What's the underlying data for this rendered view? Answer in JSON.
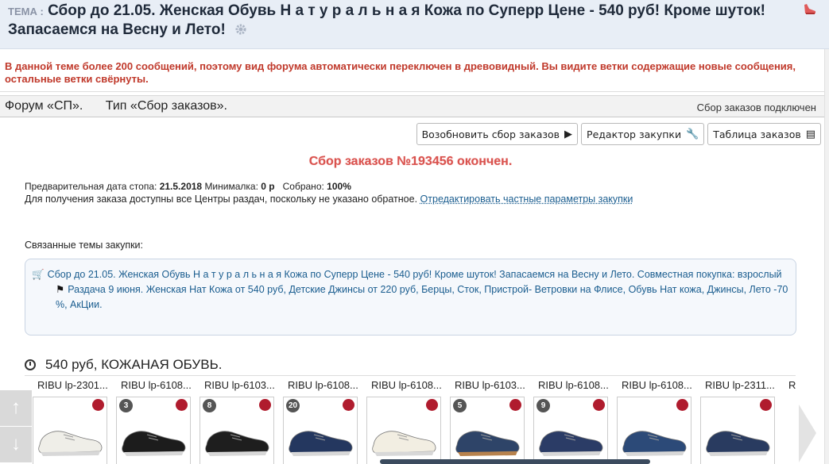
{
  "topic": {
    "label": "ТЕМА :",
    "title": "Сбор до 21.05. Женская Обувь Н а т у р а л ь н а я Кожа по Суперр Цене - 540 руб! Кроме шуток! Запасаемся на Весну и Лето!"
  },
  "notice": "В данной теме более 200 сообщений, поэтому вид форума автоматически переключен в древовидный. Вы видите ветки содержащие новые сообщения, остальные ветки свёрнуты.",
  "forum_bar": {
    "forum": "Форум «СП».",
    "type": "Тип «Сбор заказов».",
    "status": "Сбор заказов подключен"
  },
  "buttons": {
    "resume": "Возобновить сбор заказов",
    "editor": "Редактор закупки",
    "table": "Таблица заказов"
  },
  "order_status": "Сбор заказов №193456 окончен.",
  "info": {
    "stop_label": "Предварительная дата стопа:",
    "stop_value": "21.5.2018",
    "min_label": "Минималка:",
    "min_value": "0 р",
    "collected_label": "Собрано:",
    "collected_value": "100%",
    "pickup_text": "Для получения заказа доступны все Центры раздач, поскольку не указано обратное.",
    "edit_link": "Отредактировать частные параметры закупки"
  },
  "related": {
    "label": "Связанные темы закупки:",
    "topic1": "Сбор до 21.05. Женская Обувь Н а т у р а л ь н а я Кожа по Суперр Цене - 540 руб! Кроме шуток! Запасаемся на Весну и Лето. Совместная покупка: взрослый",
    "topic2": "Раздача 9 июня. Женская Нат Кожа от 540 руб, Детские Джинсы от 220 руб, Берцы, Сток, Пристрой- Ветровки на Флисе, Обувь Нат кожа, Джинсы, Лето -70 %, АкЦии."
  },
  "section": {
    "title": "540 руб, КОЖАНАЯ ОБУВЬ."
  },
  "products": [
    {
      "label": "RIBU lp-2301...",
      "badge": "",
      "color": "#efeee8"
    },
    {
      "label": "RIBU lp-6108...",
      "badge": "3",
      "color": "#1c1c1c"
    },
    {
      "label": "RIBU lp-6103...",
      "badge": "8",
      "color": "#1e1e1e"
    },
    {
      "label": "RIBU lp-6108...",
      "badge": "20",
      "color": "#24375f"
    },
    {
      "label": "RIBU lp-6108...",
      "badge": "",
      "color": "#f2eee2"
    },
    {
      "label": "RIBU lp-6103...",
      "badge": "5",
      "color": "#2e4468"
    },
    {
      "label": "RIBU lp-6108...",
      "badge": "9",
      "color": "#2b3c66"
    },
    {
      "label": "RIBU lp-6108...",
      "badge": "",
      "color": "#2c4a78"
    },
    {
      "label": "RIBU lp-2311...",
      "badge": "",
      "color": "#293b60"
    },
    {
      "label": "R",
      "badge": "",
      "color": "#333333"
    }
  ],
  "colors": {
    "accent_red": "#c0392b",
    "link_blue": "#1a5d8f",
    "header_bg": "#e8eef6"
  }
}
